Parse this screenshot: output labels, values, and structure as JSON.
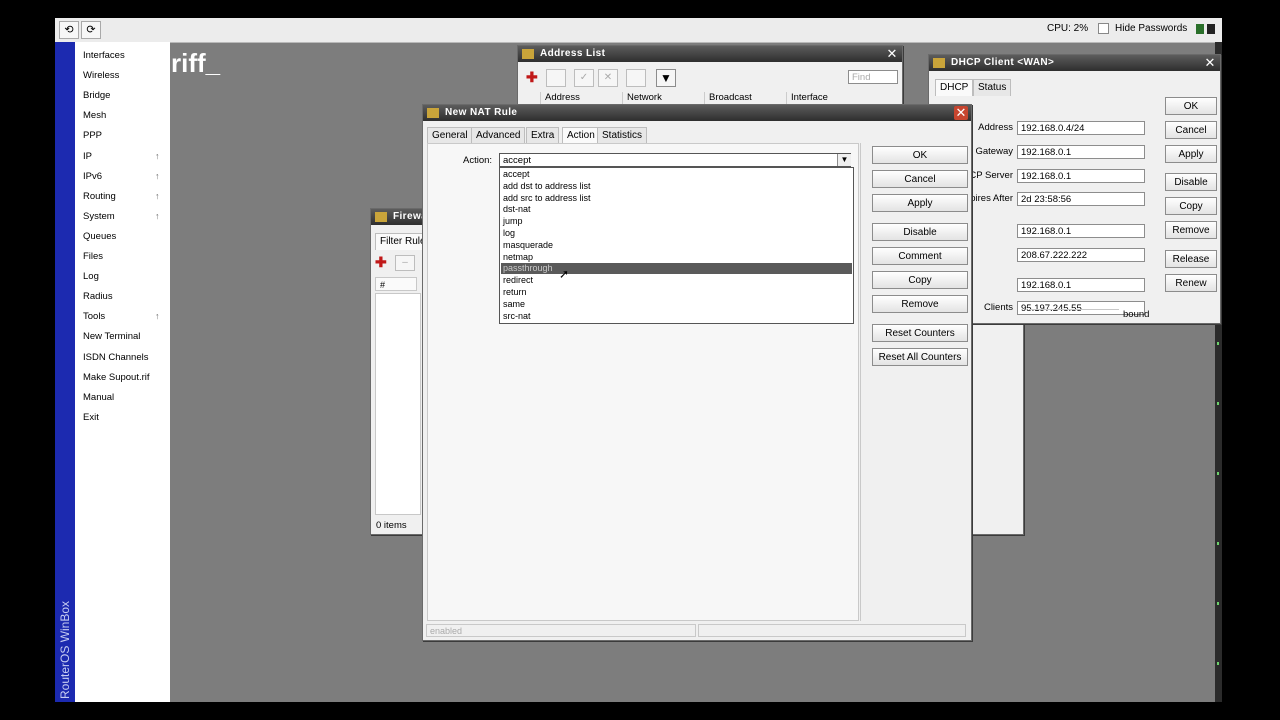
{
  "topbar": {
    "undo_glyph": "⟲",
    "redo_glyph": "⟳",
    "cpu": "CPU: 2%",
    "hide_passwords": "Hide Passwords",
    "status_colors": [
      "#2a6f2a",
      "#222222"
    ]
  },
  "brand": {
    "vertical": "RouterOS WinBox",
    "snippet": "riff_"
  },
  "menu": {
    "items": [
      "Interfaces",
      "Wireless",
      "Bridge",
      "Mesh",
      "PPP",
      "IP",
      "IPv6",
      "Routing",
      "System",
      "Queues",
      "Files",
      "Log",
      "Radius",
      "Tools",
      "New Terminal",
      "ISDN Channels",
      "Make Supout.rif",
      "Manual",
      "Exit"
    ],
    "submenu_arrow": "↑"
  },
  "firewall": {
    "title": "Firewall",
    "tab": "Filter Rules",
    "col": "#",
    "status": "0 items"
  },
  "address_list": {
    "title": "Address List",
    "find_placeholder": "Find",
    "columns": [
      "Address",
      "Network",
      "Broadcast",
      "Interface"
    ]
  },
  "dhcp": {
    "title": "DHCP Client <WAN>",
    "tabs": [
      "DHCP",
      "Status"
    ],
    "rows": [
      {
        "label": "Address",
        "value": "192.168.0.4/24"
      },
      {
        "label": "Gateway",
        "value": "192.168.0.1"
      },
      {
        "label": "DHCP Server",
        "value": "192.168.0.1"
      },
      {
        "label": "Expires After",
        "value": "2d 23:58:56"
      },
      {
        "label": "",
        "value": "192.168.0.1"
      },
      {
        "label": "",
        "value": "208.67.222.222"
      },
      {
        "label": "",
        "value": "192.168.0.1"
      },
      {
        "label": "Clients",
        "value": "95.197.245.55"
      }
    ],
    "status": "bound",
    "buttons": [
      "OK",
      "Cancel",
      "Apply",
      "Disable",
      "Copy",
      "Remove",
      "Release",
      "Renew"
    ]
  },
  "nat": {
    "title": "New NAT Rule",
    "tabs": [
      "General",
      "Advanced",
      "Extra",
      "Action",
      "Statistics"
    ],
    "action_label": "Action:",
    "action_value": "accept",
    "options": [
      "accept",
      "add dst to address list",
      "add src to address list",
      "dst-nat",
      "jump",
      "log",
      "masquerade",
      "netmap",
      "passthrough",
      "redirect",
      "return",
      "same",
      "src-nat"
    ],
    "highlighted": "passthrough",
    "buttons": [
      "OK",
      "Cancel",
      "Apply",
      "Disable",
      "Comment",
      "Copy",
      "Remove",
      "Reset Counters",
      "Reset All Counters"
    ],
    "status": "enabled"
  }
}
